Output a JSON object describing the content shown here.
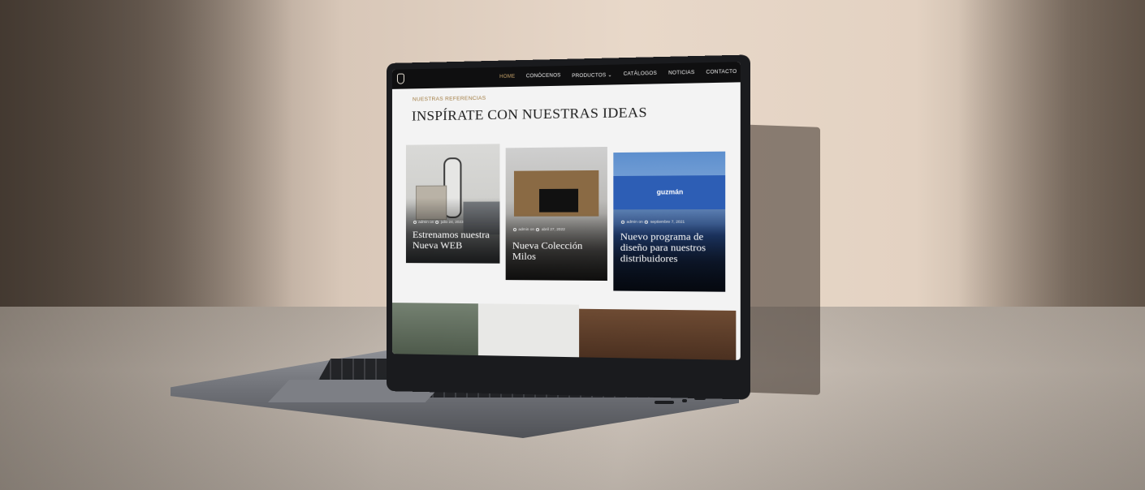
{
  "nav": {
    "items": [
      {
        "label": "HOME",
        "active": true
      },
      {
        "label": "CONÓCENOS"
      },
      {
        "label": "PRODUCTOS ⌄"
      },
      {
        "label": "CATÁLOGOS"
      },
      {
        "label": "NOTICIAS"
      },
      {
        "label": "CONTACTO"
      }
    ]
  },
  "section": {
    "eyebrow": "NUESTRAS REFERENCIAS",
    "heading": "INSPÍRATE CON NUESTRAS IDEAS"
  },
  "cards": [
    {
      "author": "admin on",
      "date": "julio 24, 2023",
      "title": "Estrenamos nuestra Nueva WEB"
    },
    {
      "author": "admin on",
      "date": "abril 27, 2022",
      "title": "Nueva Colección Milos"
    },
    {
      "author": "admin on",
      "date": "septiembre 7, 2021",
      "title": "Nuevo programa de diseño para nuestros distribuidores",
      "brand": "guzmán"
    }
  ],
  "colors": {
    "accent": "#c8a46a",
    "nav_bg": "#0f0f10",
    "eyebrow": "#a07a3f"
  }
}
